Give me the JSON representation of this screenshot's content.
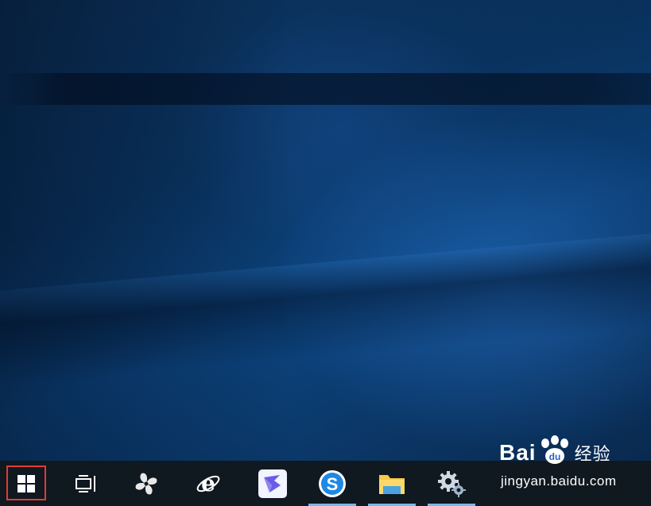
{
  "desktop": {
    "wallpaper": "windows-10-hero-blue",
    "colors": {
      "dark": "#0a2d55",
      "light": "#2878d2"
    }
  },
  "taskbar": {
    "background": "#101820",
    "active_indicator_color": "#76b9ed",
    "items": [
      {
        "name": "start-button",
        "icon": "windows-logo-icon",
        "active": false,
        "highlighted": true
      },
      {
        "name": "task-view-button",
        "icon": "task-view-icon",
        "active": false
      },
      {
        "name": "pinwheel-app",
        "icon": "pinwheel-icon",
        "active": false
      },
      {
        "name": "internet-explorer",
        "icon": "internet-explorer-icon",
        "active": false
      },
      {
        "name": "swift-app",
        "icon": "swift-bird-icon",
        "active": false
      },
      {
        "name": "sogou-browser",
        "icon": "sogou-s-icon",
        "active": true
      },
      {
        "name": "file-explorer",
        "icon": "folder-icon",
        "active": true
      },
      {
        "name": "settings",
        "icon": "gears-icon",
        "active": true
      }
    ]
  },
  "highlight": {
    "color": "#e53935",
    "target": "start-button"
  },
  "watermark": {
    "brand": "Bai",
    "brand2": "du",
    "cn": "经验",
    "url": "jingyan.baidu.com"
  }
}
